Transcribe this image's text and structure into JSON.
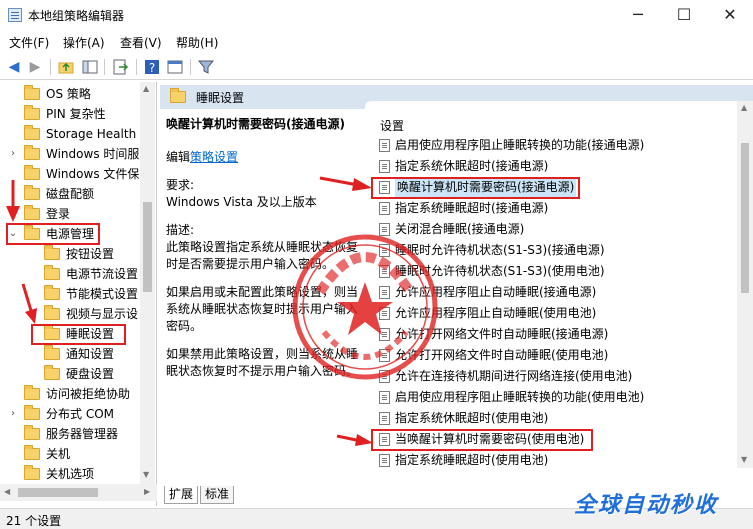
{
  "window": {
    "title": "本地组策略编辑器",
    "controls": {
      "minimize": "─",
      "maximize": "☐",
      "close": "✕"
    }
  },
  "menu": [
    "文件(F)",
    "操作(A)",
    "查看(V)",
    "帮助(H)"
  ],
  "toolbar": {
    "icons": [
      "back-arrow-icon",
      "forward-arrow-icon",
      "up-folder-icon",
      "show-hide-tree-icon",
      "export-list-icon",
      "help-icon",
      "properties-icon",
      "filter-icon"
    ]
  },
  "tree": {
    "items": [
      {
        "label": "OS 策略",
        "level": 1,
        "chevron": ""
      },
      {
        "label": "PIN 复杂性",
        "level": 1,
        "chevron": ""
      },
      {
        "label": "Storage Health",
        "level": 1,
        "chevron": ""
      },
      {
        "label": "Windows 时间服",
        "level": 1,
        "chevron": "›"
      },
      {
        "label": "Windows 文件保",
        "level": 1,
        "chevron": ""
      },
      {
        "label": "磁盘配额",
        "level": 1,
        "chevron": ""
      },
      {
        "label": "登录",
        "level": 1,
        "chevron": ""
      },
      {
        "label": "电源管理",
        "level": 1,
        "chevron": "⌄"
      },
      {
        "label": "按钮设置",
        "level": 2,
        "chevron": ""
      },
      {
        "label": "电源节流设置",
        "level": 2,
        "chevron": ""
      },
      {
        "label": "节能模式设置",
        "level": 2,
        "chevron": ""
      },
      {
        "label": "视频与显示设",
        "level": 2,
        "chevron": ""
      },
      {
        "label": "睡眠设置",
        "level": 2,
        "chevron": ""
      },
      {
        "label": "通知设置",
        "level": 2,
        "chevron": ""
      },
      {
        "label": "硬盘设置",
        "level": 2,
        "chevron": ""
      },
      {
        "label": "访问被拒绝协助",
        "level": 1,
        "chevron": ""
      },
      {
        "label": "分布式 COM",
        "level": 1,
        "chevron": "›"
      },
      {
        "label": "服务器管理器",
        "level": 1,
        "chevron": ""
      },
      {
        "label": "关机",
        "level": 1,
        "chevron": ""
      },
      {
        "label": "关机选项",
        "level": 1,
        "chevron": ""
      }
    ]
  },
  "header": {
    "title": "睡眠设置"
  },
  "description": {
    "policy_title": "唤醒计算机时需要密码(接通电源)",
    "edit_prefix": "编辑",
    "edit_link": "策略设置",
    "requirements_label": "要求:",
    "requirements": "Windows Vista 及以上版本",
    "desc_label": "描述:",
    "desc_1": "此策略设置指定系统从睡眠状态恢复时是否需要提示用户输入密码。",
    "desc_2": "如果启用或未配置此策略设置，则当系统从睡眠状态恢复时提示用户输入密码。",
    "desc_3": "如果禁用此策略设置，则当系统从睡眠状态恢复时不提示用户输入密码。"
  },
  "list": {
    "header": "设置",
    "rows": [
      "启用使应用程序阻止睡眠转换的功能(接通电源)",
      "指定系统休眠超时(接通电源)",
      "唤醒计算机时需要密码(接通电源)",
      "指定系统睡眠超时(接通电源)",
      "关闭混合睡眠(接通电源)",
      "睡眠时允许待机状态(S1-S3)(接通电源)",
      "睡眠时允许待机状态(S1-S3)(使用电池)",
      "允许应用程序阻止自动睡眠(接通电源)",
      "允许应用程序阻止自动睡眠(使用电池)",
      "允许打开网络文件时自动睡眠(接通电源)",
      "允许打开网络文件时自动睡眠(使用电池)",
      "允许在连接待机期间进行网络连接(使用电池)",
      "启用使应用程序阻止睡眠转换的功能(使用电池)",
      "指定系统休眠超时(使用电池)",
      "当唤醒计算机时需要密码(使用电池)",
      "指定系统睡眠超时(使用电池)"
    ]
  },
  "tabs": [
    "扩展",
    "标准"
  ],
  "status": {
    "text": "21 个设置"
  },
  "watermark": {
    "text": "全球自动秒收"
  },
  "colors": {
    "annotation_red": "#e02020",
    "header_bg": "#d9e4f1",
    "link": "#0066cc",
    "watermark": "#1e6fd9"
  }
}
